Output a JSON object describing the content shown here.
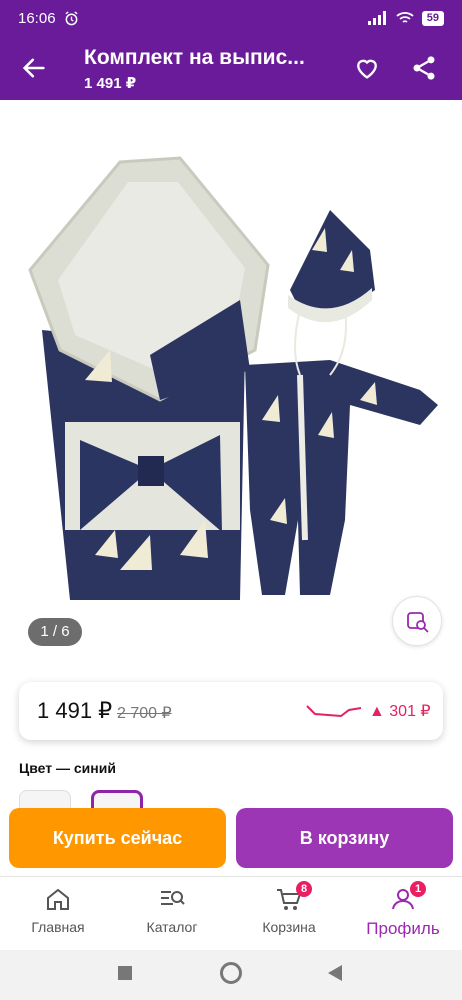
{
  "status_bar": {
    "time": "16:06",
    "battery": "59"
  },
  "header": {
    "title": "Комплект на выпис...",
    "subtitle": "1 491 ₽",
    "back_icon": "arrow-left-icon",
    "favorite_icon": "heart-icon",
    "share_icon": "share-icon"
  },
  "gallery": {
    "counter": "1 / 6",
    "search_icon": "image-search-icon"
  },
  "price": {
    "current": "1 491 ₽",
    "old": "2 700 ₽",
    "delta": "▲ 301 ₽"
  },
  "color": {
    "label": "Цвет — синий"
  },
  "actions": {
    "buy_now": "Купить сейчас",
    "add_to_cart": "В корзину"
  },
  "bottom_nav": [
    {
      "label": "Главная",
      "icon": "home-icon"
    },
    {
      "label": "Каталог",
      "icon": "catalog-search-icon"
    },
    {
      "label": "Корзина",
      "icon": "cart-icon",
      "badge": "8"
    },
    {
      "label": "Профиль",
      "icon": "profile-icon",
      "badge": "1"
    }
  ],
  "colors": {
    "brand": "#6a1b9a",
    "buy": "#ff9800",
    "cart": "#9c36b5",
    "accent": "#e0245e"
  }
}
